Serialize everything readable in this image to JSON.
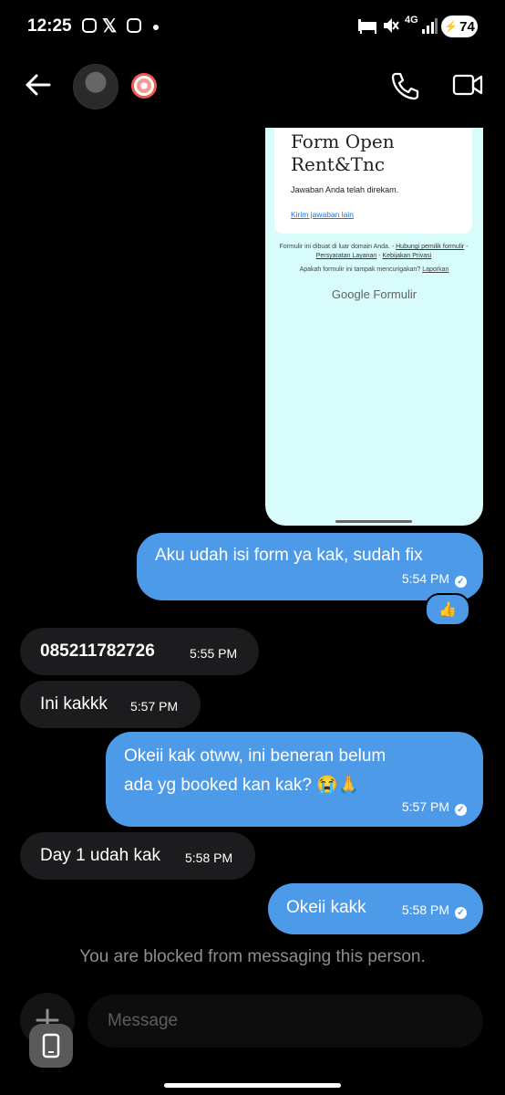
{
  "status_bar": {
    "time": "12:25",
    "x_glyph": "𝕏",
    "network": "4G",
    "battery": "74"
  },
  "header": {
    "back_icon": "arrow-left-icon",
    "call_icon": "phone-icon",
    "video_icon": "video-camera-icon",
    "badge_icon": "nazar-amulet-icon"
  },
  "screenshot": {
    "form_title": "Form Open Rent&Tnc",
    "response_recorded": "Jawaban Anda telah direkam.",
    "submit_another": "Kirim jawaban lain",
    "footer_text": "Formulir ini dibuat di luar domain Anda. -",
    "footer_link_owner": "Hubungi pemilik formulir",
    "footer_sep1": " - ",
    "footer_link_terms": "Persyaratan Layanan",
    "footer_sep2": " - ",
    "footer_link_privacy": "Kebijakan Privasi",
    "suspicious_text": "Apakah formulir ini tampak mencurigakan?",
    "report_link": "Laporkan",
    "logo": "Google Formulir"
  },
  "messages": [
    {
      "direction": "out",
      "text": "Aku udah isi form ya kak, sudah fix",
      "time": "5:54 PM"
    },
    {
      "direction": "in",
      "text": "085211782726",
      "time": "5:55 PM"
    },
    {
      "direction": "in",
      "text": "Ini kakkk",
      "time": "5:57 PM"
    },
    {
      "direction": "out",
      "text_line1": "Okeii kak otww, ini beneran belum",
      "text_line2": "ada yg booked kan kak? 😭🙏",
      "time": "5:57 PM"
    },
    {
      "direction": "in",
      "text": "Day 1 udah kak",
      "time": "5:58 PM"
    },
    {
      "direction": "out",
      "text": "Okeii kakk",
      "time": "5:58 PM"
    }
  ],
  "reaction": "👍",
  "blocked_notice": "You are blocked from messaging this person.",
  "composer": {
    "placeholder": "Message"
  },
  "colors": {
    "outgoing_bubble": "#4d9be8",
    "incoming_bubble": "#1c1c1e",
    "screenshot_bg": "#d7fcf9"
  }
}
